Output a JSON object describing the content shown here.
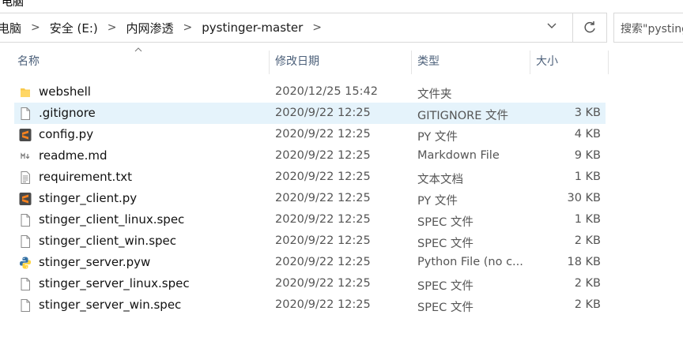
{
  "window": {
    "partial_title": "电脑"
  },
  "breadcrumb": [
    "电脑",
    "安全 (E:)",
    "内网渗透",
    "pystinger-master"
  ],
  "search": {
    "placeholder": "搜索\"pystinger-master\""
  },
  "columns": {
    "name": "名称",
    "date": "修改日期",
    "type": "类型",
    "size": "大小"
  },
  "files": [
    {
      "name": "webshell",
      "date": "2020/12/25 15:42",
      "type": "文件夹",
      "size": "",
      "icon": "folder-icon"
    },
    {
      "name": ".gitignore",
      "date": "2020/9/22 12:25",
      "type": "GITIGNORE 文件",
      "size": "3 KB",
      "icon": "file-icon"
    },
    {
      "name": "config.py",
      "date": "2020/9/22 12:25",
      "type": "PY 文件",
      "size": "4 KB",
      "icon": "sublime-icon"
    },
    {
      "name": "readme.md",
      "date": "2020/9/22 12:25",
      "type": "Markdown File",
      "size": "9 KB",
      "icon": "markdown-icon"
    },
    {
      "name": "requirement.txt",
      "date": "2020/9/22 12:25",
      "type": "文本文档",
      "size": "1 KB",
      "icon": "text-file-icon"
    },
    {
      "name": "stinger_client.py",
      "date": "2020/9/22 12:25",
      "type": "PY 文件",
      "size": "30 KB",
      "icon": "sublime-icon"
    },
    {
      "name": "stinger_client_linux.spec",
      "date": "2020/9/22 12:25",
      "type": "SPEC 文件",
      "size": "1 KB",
      "icon": "file-icon"
    },
    {
      "name": "stinger_client_win.spec",
      "date": "2020/9/22 12:25",
      "type": "SPEC 文件",
      "size": "2 KB",
      "icon": "file-icon"
    },
    {
      "name": "stinger_server.pyw",
      "date": "2020/9/22 12:25",
      "type": "Python File (no c...",
      "size": "18 KB",
      "icon": "python-icon"
    },
    {
      "name": "stinger_server_linux.spec",
      "date": "2020/9/22 12:25",
      "type": "SPEC 文件",
      "size": "2 KB",
      "icon": "file-icon"
    },
    {
      "name": "stinger_server_win.spec",
      "date": "2020/9/22 12:25",
      "type": "SPEC 文件",
      "size": "2 KB",
      "icon": "file-icon"
    }
  ],
  "colors": {
    "selection": "#e5f3fb",
    "header_text": "#4c607a",
    "folder": "#f8c94b",
    "sublime": "#f4811f"
  }
}
